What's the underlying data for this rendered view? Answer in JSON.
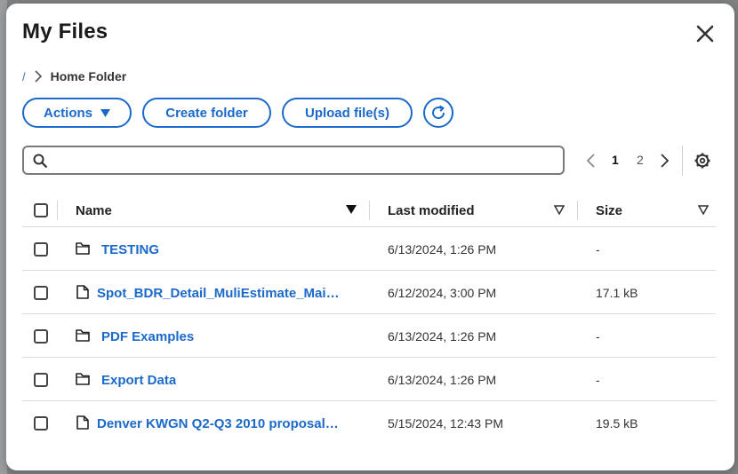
{
  "modal": {
    "title": "My Files",
    "close_icon": "close-icon"
  },
  "breadcrumb": {
    "root": "/",
    "current": "Home Folder"
  },
  "toolbar": {
    "actions_label": "Actions",
    "create_folder_label": "Create folder",
    "upload_label": "Upload file(s)",
    "refresh_icon": "refresh-icon"
  },
  "search": {
    "value": "",
    "placeholder": ""
  },
  "pagination": {
    "current_page": "1",
    "other_page": "2"
  },
  "table": {
    "columns": {
      "name": "Name",
      "last_modified": "Last modified",
      "size": "Size"
    },
    "rows": [
      {
        "type": "folder",
        "name": "TESTING",
        "modified": "6/13/2024, 1:26 PM",
        "size": "-"
      },
      {
        "type": "file",
        "name": "Spot_BDR_Detail_MuliEstimate_Mai…",
        "modified": "6/12/2024, 3:00 PM",
        "size": "17.1 kB"
      },
      {
        "type": "folder",
        "name": "PDF Examples",
        "modified": "6/13/2024, 1:26 PM",
        "size": "-"
      },
      {
        "type": "folder",
        "name": "Export Data",
        "modified": "6/13/2024, 1:26 PM",
        "size": "-"
      },
      {
        "type": "file",
        "name": "Denver KWGN Q2-Q3 2010 proposal…",
        "modified": "5/15/2024, 12:43 PM",
        "size": "19.5 kB"
      }
    ]
  },
  "colors": {
    "accent": "#1b6ac9",
    "overlay": "#7f8183"
  }
}
